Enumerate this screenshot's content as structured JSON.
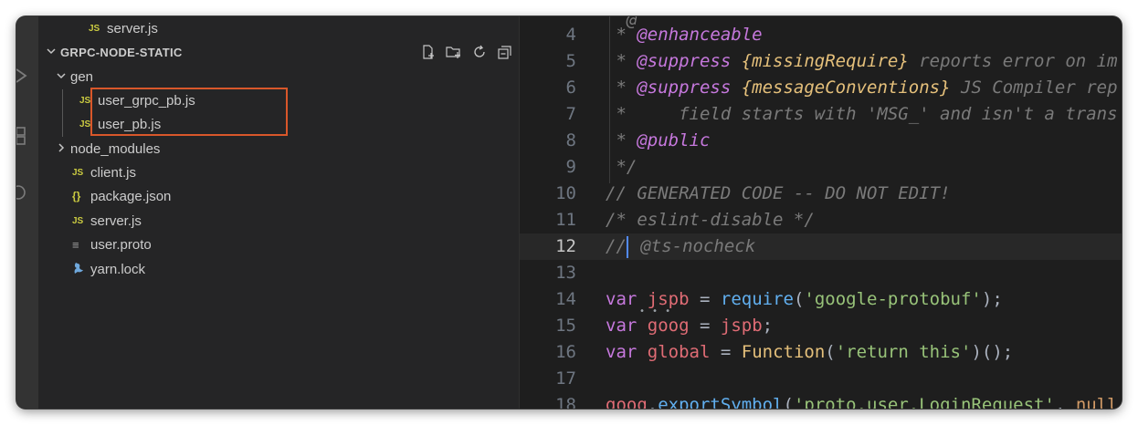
{
  "explorer": {
    "top_partial_file": "server.js",
    "section_title": "GRPC-NODE-STATIC",
    "header_actions": [
      "new-file-icon",
      "new-folder-icon",
      "refresh-icon",
      "collapse-all-icon"
    ],
    "tree": [
      {
        "name": "gen",
        "type": "folder",
        "expanded": true
      },
      {
        "name": "user_grpc_pb.js",
        "type": "js",
        "icon": "JS"
      },
      {
        "name": "user_pb.js",
        "type": "js",
        "icon": "JS"
      },
      {
        "name": "node_modules",
        "type": "folder",
        "expanded": false
      },
      {
        "name": "client.js",
        "type": "js",
        "icon": "JS"
      },
      {
        "name": "package.json",
        "type": "json",
        "icon": "{}"
      },
      {
        "name": "server.js",
        "type": "js",
        "icon": "JS"
      },
      {
        "name": "user.proto",
        "type": "proto",
        "icon": "≡"
      },
      {
        "name": "yarn.lock",
        "type": "yarn",
        "icon": "yarn-icon"
      }
    ],
    "highlight_color": "#d9572a"
  },
  "editor": {
    "current_line": 12,
    "lines": [
      {
        "n": "4",
        "tokens": [
          [
            "c-com",
            " * "
          ],
          [
            "c-tag",
            "@enhanceable"
          ]
        ]
      },
      {
        "n": "5",
        "tokens": [
          [
            "c-com",
            " * "
          ],
          [
            "c-tag",
            "@suppress"
          ],
          [
            "c-com",
            " "
          ],
          [
            "c-type",
            "{missingRequire}"
          ],
          [
            "c-com",
            " reports error on im"
          ]
        ]
      },
      {
        "n": "6",
        "tokens": [
          [
            "c-com",
            " * "
          ],
          [
            "c-tag",
            "@suppress"
          ],
          [
            "c-com",
            " "
          ],
          [
            "c-type",
            "{messageConventions}"
          ],
          [
            "c-com",
            " JS Compiler rep"
          ]
        ]
      },
      {
        "n": "7",
        "tokens": [
          [
            "c-com",
            " *     field starts with 'MSG_' and isn't a trans"
          ]
        ]
      },
      {
        "n": "8",
        "tokens": [
          [
            "c-com",
            " * "
          ],
          [
            "c-tag",
            "@public"
          ]
        ]
      },
      {
        "n": "9",
        "tokens": [
          [
            "c-com",
            " */"
          ]
        ]
      },
      {
        "n": "10",
        "tokens": [
          [
            "c-com",
            "// GENERATED CODE -- DO NOT EDIT!"
          ]
        ]
      },
      {
        "n": "11",
        "tokens": [
          [
            "c-com",
            "/* eslint-disable */"
          ]
        ]
      },
      {
        "n": "12",
        "tokens": [
          [
            "c-com",
            "//"
          ],
          [
            "caret",
            ""
          ],
          [
            "c-com",
            " @ts-nocheck"
          ]
        ]
      },
      {
        "n": "13",
        "tokens": []
      },
      {
        "n": "14",
        "tokens": [
          [
            "c-kw",
            "var"
          ],
          [
            "c-plain",
            " "
          ],
          [
            "c-var",
            "jspb"
          ],
          [
            "c-plain",
            " = "
          ],
          [
            "c-fn",
            "require"
          ],
          [
            "c-plain",
            "("
          ],
          [
            "c-str",
            "'google-protobuf'"
          ],
          [
            "c-plain",
            ");"
          ]
        ]
      },
      {
        "n": "15",
        "tokens": [
          [
            "c-kw",
            "var"
          ],
          [
            "c-plain",
            " "
          ],
          [
            "c-var",
            "goog"
          ],
          [
            "c-plain",
            " = "
          ],
          [
            "c-var",
            "jspb"
          ],
          [
            "c-plain",
            ";"
          ]
        ]
      },
      {
        "n": "16",
        "tokens": [
          [
            "c-kw",
            "var"
          ],
          [
            "c-plain",
            " "
          ],
          [
            "c-var",
            "global"
          ],
          [
            "c-plain",
            " = "
          ],
          [
            "c-cls",
            "Function"
          ],
          [
            "c-plain",
            "("
          ],
          [
            "c-str",
            "'return this'"
          ],
          [
            "c-plain",
            ")();"
          ]
        ]
      },
      {
        "n": "17",
        "tokens": []
      },
      {
        "n": "18",
        "tokens": [
          [
            "c-var",
            "goog"
          ],
          [
            "c-plain",
            "."
          ],
          [
            "c-fn",
            "exportSymbol"
          ],
          [
            "c-plain",
            "("
          ],
          [
            "c-str",
            "'proto.user.LoginRequest'"
          ],
          [
            "c-plain",
            ", "
          ],
          [
            "c-num",
            "null"
          ]
        ]
      }
    ]
  }
}
